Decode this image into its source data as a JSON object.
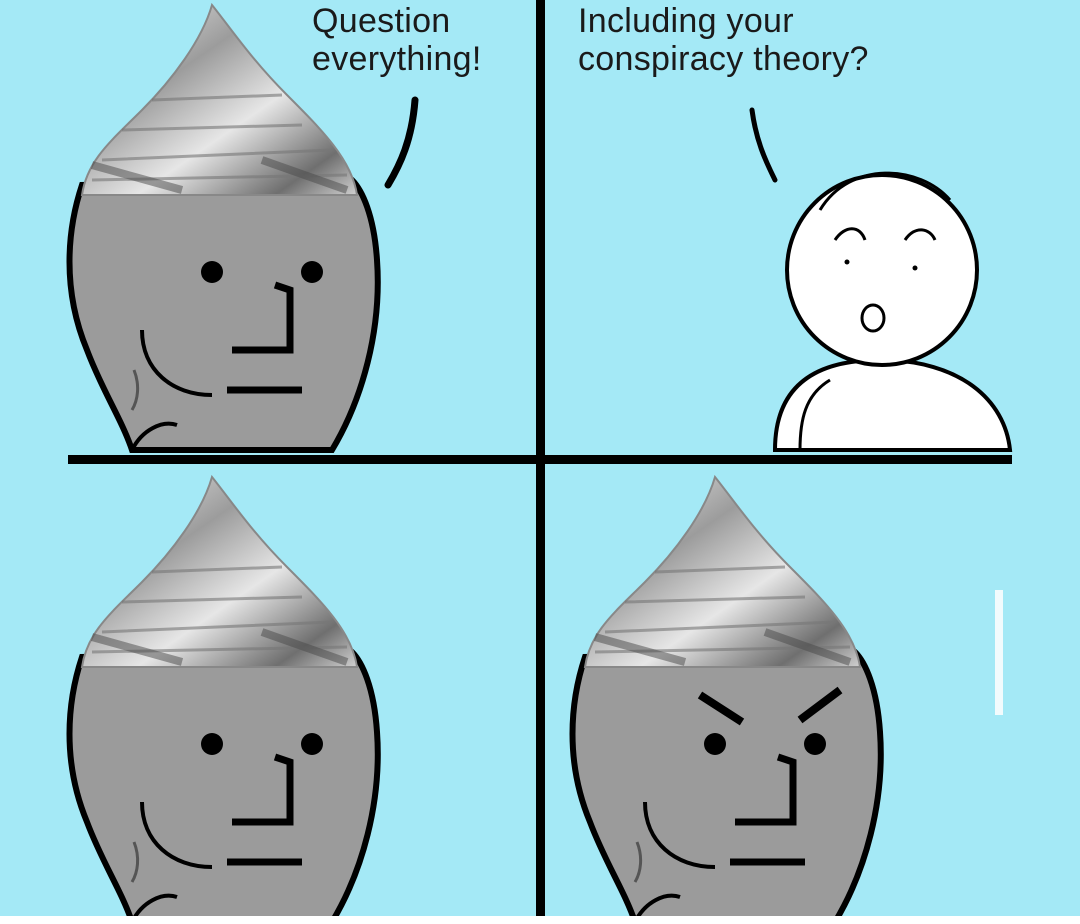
{
  "panels": [
    {
      "id": "top-left",
      "speech": {
        "line1": "Question",
        "line2": "everything!"
      }
    },
    {
      "id": "top-right",
      "speech": {
        "line1": "Including your",
        "line2": "conspiracy theory?"
      }
    },
    {
      "id": "bottom-left"
    },
    {
      "id": "bottom-right"
    }
  ],
  "colors": {
    "background": "#a4e9f6",
    "head": "#9b9b9b",
    "foil": "#c9c9c9",
    "divider": "#000000"
  }
}
